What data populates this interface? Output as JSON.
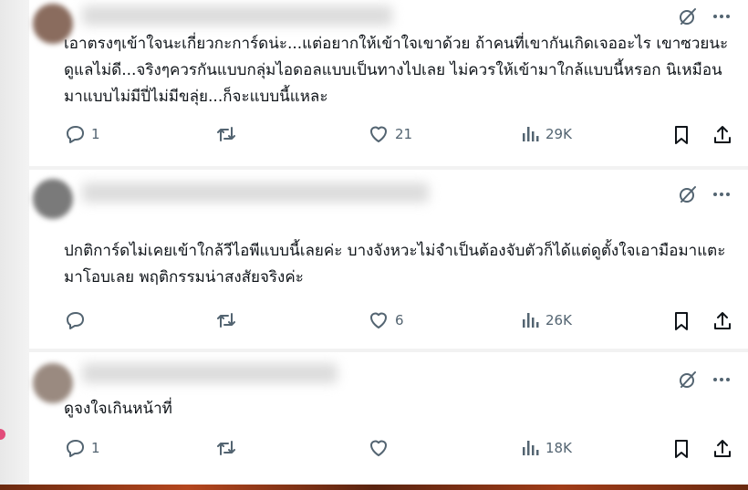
{
  "posts": [
    {
      "text": "เอาตรงๆเข้าใจนะเกี่ยวกะการ์ดน่ะ...แต่อยากให้เข้าใจเขาด้วย ถ้าคนที่เขากันเกิดเจออะไร เขาซวยนะ ดูแลไม่ดี...จริงๆควรกันแบบกลุ่มไอดอลแบบเป็นทางไปเลย ไม่ควรให้เข้ามาใกล้แบบนี้หรอก นิเหมือนมาแบบไม่มีปี่ไม่มีขลุ่ย...ก็จะแบบนี้แหละ",
      "replies": "1",
      "likes": "21",
      "views": "29K"
    },
    {
      "text": "ปกติการ์ดไม่เคยเข้าใกล้วีไอพีแบบนี้เลยค่ะ บางจังหวะไม่จำเป็นต้องจับตัวก็ได้แต่ดูตั้งใจเอามือมาแตะมาโอบเลย พฤติกรรมน่าสงสัยจริงค่ะ",
      "replies": "",
      "likes": "6",
      "views": "26K"
    },
    {
      "text": "ดูจงใจเกินหน้าที่",
      "replies": "1",
      "likes": "",
      "views": "18K"
    }
  ],
  "icons": {
    "grok": "grok-icon",
    "more": "more-icon",
    "reply": "reply-icon",
    "repost": "repost-icon",
    "like": "heart-icon",
    "views": "views-icon",
    "bookmark": "bookmark-icon",
    "share": "share-icon"
  },
  "colors": {
    "text": "#0f1419",
    "muted": "#536471",
    "background": "#ffffff"
  }
}
